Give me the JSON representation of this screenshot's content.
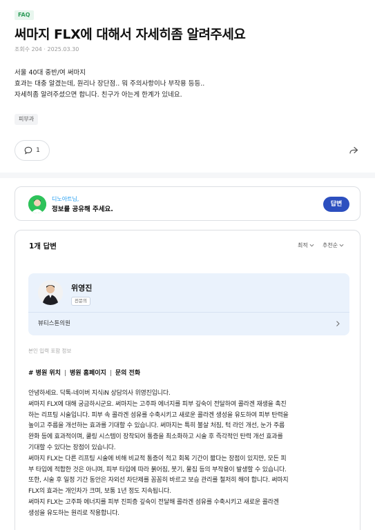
{
  "question": {
    "badge": "FAQ",
    "title": "써마지 FLX에 대해서 자세히좀 알려주세요",
    "meta": "조회수 204 · 2025.03.30",
    "body_lines": [
      "서울 40대 중반/여 써마지",
      "효과는 대충 알겠는데, 원리나 장단점.. 뭐 주의사항이나 부작용 등등..",
      "자세히좀 알려주셨으면 합니다. 친구가 아는게 한계가 있네요."
    ],
    "tag": "피부과"
  },
  "actions": {
    "comment_count": "1",
    "comment_icon": "speech-bubble-icon",
    "share_icon": "share-arrow-icon"
  },
  "prompt": {
    "user_name": "디노아트님,",
    "text": "정보를 공유해 주세요.",
    "answer_button": "답변"
  },
  "answers": {
    "count_label": "1개 답변",
    "sort_latest": "최적",
    "sort_recommend": "추천순",
    "doctor": {
      "name": "위영진",
      "role": "전문의",
      "clinic": "뷰티스톤의원"
    },
    "input_info": "본인 입력 포함 정보",
    "links": [
      "# 병원 위치",
      "병원 홈페이지",
      "문의 전화"
    ],
    "body_lines": [
      "안녕하세요. 닥톡-네이버 지식iN 상담의사 위영진입니다.",
      "써마지 FLX에 대해 궁금하시군요. 써마지는 고주파 에너지를 피부 깊숙이 전달하여 콜라겐 재생을 촉진",
      "하는 리프팅 시술입니다. 피부 속 콜라겐 섬유를 수축시키고 새로운 콜라겐 생성을 유도하여 피부 탄력을",
      "높이고 주름을 개선하는 효과를 기대할 수 있습니다. 써마지는 특히 불살 처짐, 턱 라인 개선, 눈가 주름",
      "완화 등에 효과적이며, 쿨링 시스템이 장착되어 통증을 최소화하고 시술 후 즉각적인 탄력 개선 효과를",
      "기대할 수 있다는 장점이 있습니다.",
      "써마지 FLX는 다른 리프팅 시술에 비해 비교적 통증이 적고 회복 기간이 짧다는 장점이 있지만, 모든 피",
      "부 타입에 적합한 것은 아니며, 피부 타입에 따라 붉어짐, 붓기, 물집 등의 부작용이 발생할 수 있습니다.",
      "또한, 시술 후 일정 기간 동안은 자외선 차단제를 꼼꼼히 바르고 보습 관리를 철저히 해야 합니다. 써마지",
      "FLX의 효과는 개인차가 크며, 보통 1년 정도 지속됩니다.",
      "써마지 FLX는 고주파 에너지를 피부 진피층 깊숙이 전달해 콜라겐 섬유를 수축시키고 새로운 콜라겐",
      "생성을 유도하는 원리로 작용합니다."
    ]
  }
}
